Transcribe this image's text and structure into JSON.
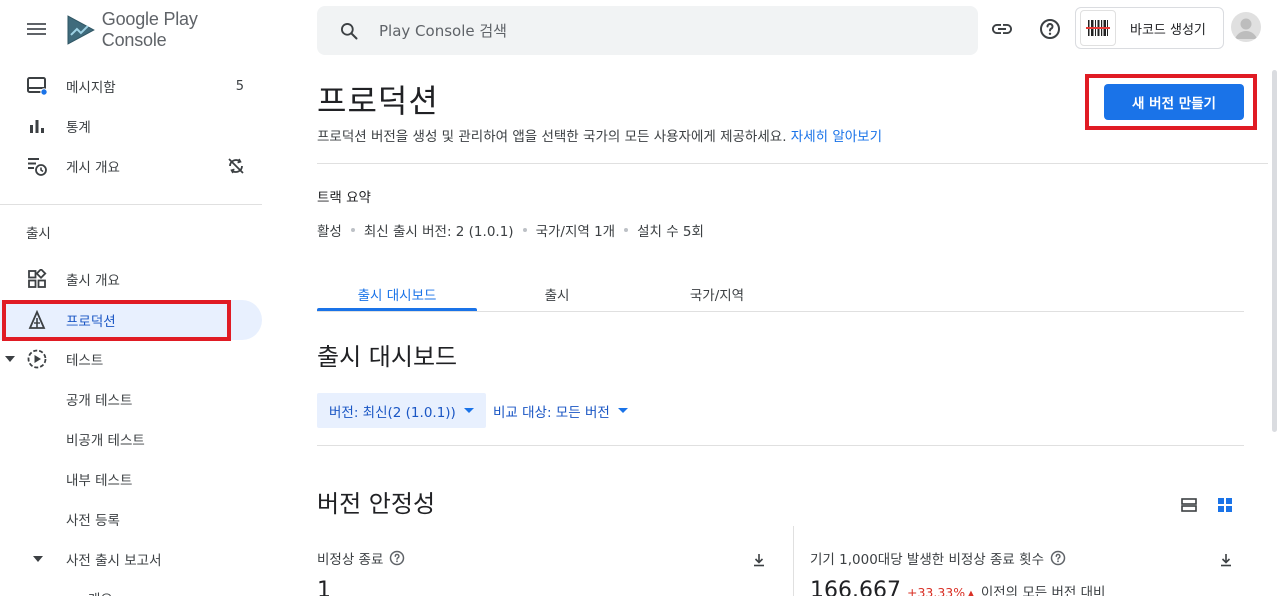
{
  "header": {
    "logo_text": "Google Play Console",
    "search_placeholder": "Play Console 검색",
    "app_name": "바코드 생성기",
    "icons": [
      "menu-icon",
      "link-icon",
      "help-icon",
      "avatar-icon"
    ]
  },
  "sidebar": {
    "top_items": [
      {
        "label": "메시지함",
        "badge": "5",
        "icon": "inbox-icon"
      },
      {
        "label": "통계",
        "icon": "bar-chart-icon"
      },
      {
        "label": "게시 개요",
        "icon": "schedule-list-icon",
        "trail_icon": "sync-off-icon"
      }
    ],
    "section_label": "출시",
    "release_items": [
      {
        "label": "출시 개요",
        "icon": "dashboard-icon"
      },
      {
        "label": "프로덕션",
        "icon": "production-icon",
        "active": true
      },
      {
        "label": "테스트",
        "icon": "play-circle-icon",
        "expanded": true
      }
    ],
    "test_sub_items": [
      {
        "label": "공개 테스트"
      },
      {
        "label": "비공개 테스트"
      },
      {
        "label": "내부 테스트"
      },
      {
        "label": "사전 등록"
      }
    ],
    "prelaunch_label": "사전 출시 보고서",
    "prelaunch_next": "개요"
  },
  "main": {
    "title": "프로덕션",
    "description": "프로덕션 버전을 생성 및 관리하여 앱을 선택한 국가의 모든 사용자에게 제공하세요.",
    "learn_more": "자세히 알아보기",
    "create_button": "새 버전 만들기",
    "track_summary_title": "트랙 요약",
    "track_summary": [
      "활성",
      "최신 출시 버전: 2 (1.0.1)",
      "국가/지역 1개",
      "설치 수 5회"
    ],
    "tabs": [
      {
        "label": "출시 대시보드",
        "active": true
      },
      {
        "label": "출시"
      },
      {
        "label": "국가/지역"
      }
    ],
    "dashboard_title": "출시 대시보드",
    "version_filter": "버전: 최신(2 (1.0.1))",
    "compare_filter": "비교 대상: 모든 버전",
    "stability_title": "버전 안정성",
    "cards": [
      {
        "label": "비정상 종료",
        "value": "1"
      },
      {
        "label": "기기 1,000대당 발생한 비정상 종료 횟수",
        "value": "166.667",
        "delta": "+33.33%",
        "compare": "이전의 모든 버전 대비"
      }
    ]
  },
  "colors": {
    "accent": "#1a73e8",
    "highlight": "#e01b24",
    "active_bg": "#e8f0fe"
  }
}
